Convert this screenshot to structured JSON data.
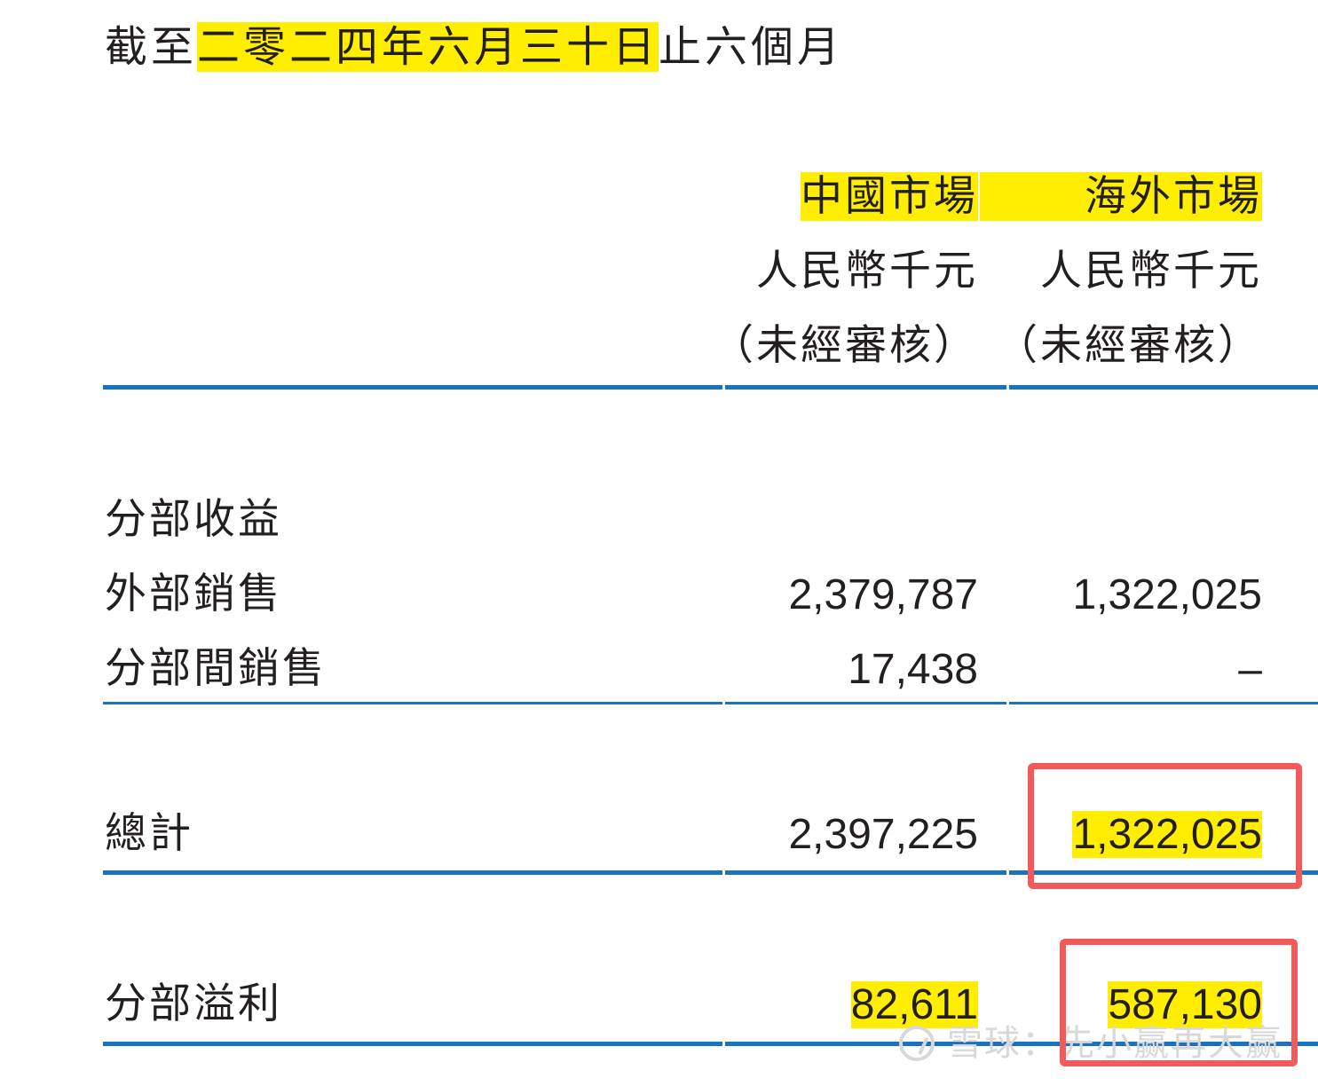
{
  "period": {
    "prefix": "截至",
    "date": "二零二四年六月三十日",
    "suffix": "止六個月"
  },
  "columns": [
    {
      "market": "中國市場",
      "currency": "人民幣千元",
      "audit": "（未經審核）"
    },
    {
      "market": "海外市場",
      "currency": "人民幣千元",
      "audit": "（未經審核）"
    }
  ],
  "section_heading": "分部收益",
  "rows": [
    {
      "label": "外部銷售",
      "values": [
        "2,379,787",
        "1,322,025"
      ]
    },
    {
      "label": "分部間銷售",
      "values": [
        "17,438",
        "–"
      ]
    }
  ],
  "total": {
    "label": "總計",
    "values": [
      "2,397,225",
      "1,322,025"
    ]
  },
  "profit": {
    "label": "分部溢利",
    "values": [
      "82,611",
      "587,130"
    ]
  },
  "watermark": "雪球：先小赢再大赢",
  "colors": {
    "rule": "#1a73c0",
    "highlight": "#ffee00",
    "annotation_box": "#f25a5a",
    "text": "#231f20"
  }
}
